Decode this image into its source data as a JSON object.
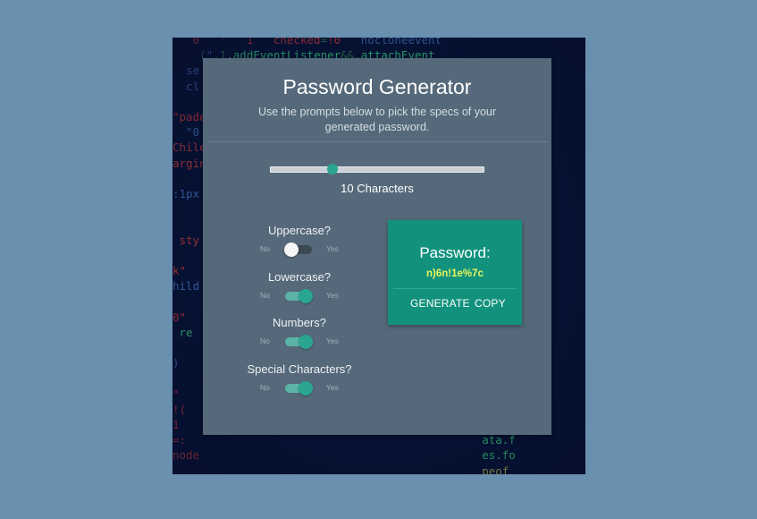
{
  "header": {
    "title": "Password Generator",
    "subtitle": "Use the prompts below to pick the specs of your generated password."
  },
  "length_slider": {
    "value": 10,
    "label": "10 Characters"
  },
  "options": [
    {
      "label": "Uppercase?",
      "off_label": "No",
      "on_label": "Yes",
      "checked": false
    },
    {
      "label": "Lowercase?",
      "off_label": "No",
      "on_label": "Yes",
      "checked": true
    },
    {
      "label": "Numbers?",
      "off_label": "No",
      "on_label": "Yes",
      "checked": true
    },
    {
      "label": "Special Characters?",
      "off_label": "No",
      "on_label": "Yes",
      "checked": true
    }
  ],
  "result": {
    "title": "Password:",
    "value": "n)6n!1e%7c",
    "generate_label": "GENERATE",
    "copy_label": "COPY"
  },
  "colors": {
    "page_background": "#6990ae",
    "card_background": "#55697a",
    "accent": "#12927c",
    "password_text": "#e9f55a"
  }
}
